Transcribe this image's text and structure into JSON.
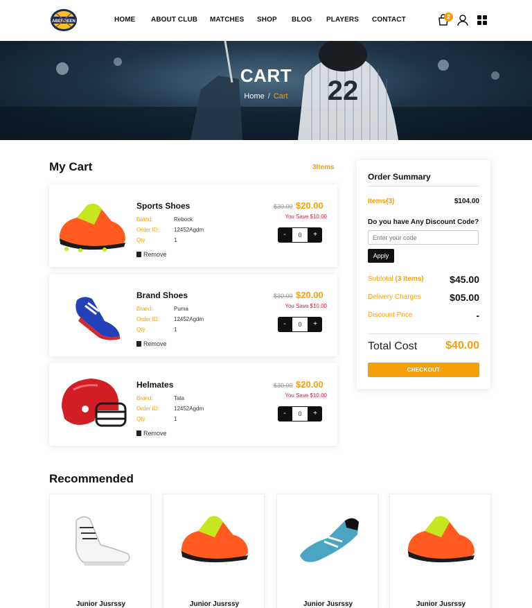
{
  "brand": {
    "logo_text": "ABERDEEN",
    "accent": "#f5a00b"
  },
  "nav": [
    {
      "label": "HOME"
    },
    {
      "label": "ABOUT CLUB"
    },
    {
      "label": "MATCHES"
    },
    {
      "label": "SHOP"
    },
    {
      "label": "BLOG"
    },
    {
      "label": "PLAYERS"
    },
    {
      "label": "CONTACT"
    }
  ],
  "header_icons": {
    "cart": "bag-icon",
    "cart_count": "2",
    "user": "user-icon",
    "menu": "grid-icon"
  },
  "hero": {
    "title": "CART",
    "breadcrumb_home": "Home",
    "breadcrumb_sep": "/",
    "breadcrumb_current": "Cart"
  },
  "cart": {
    "title": "My Cart",
    "count_label": "3Items",
    "labels": {
      "brand": "Brand:",
      "order_id": "Order ID:",
      "qty": "Qty",
      "remove": "Remove",
      "you_save": "You Save"
    },
    "items": [
      {
        "name": "Sports Shoes",
        "brand": "Rebock",
        "order_id": "12452Agdm",
        "qty": "1",
        "old_price": "$30.00",
        "price": "$20.00",
        "save": "You Save $10.00",
        "stepper_value": "0",
        "image": "orange-cleats"
      },
      {
        "name": "Brand Shoes",
        "brand": "Puma",
        "order_id": "12452Agdm",
        "qty": "1",
        "old_price": "$30.00",
        "price": "$20.00",
        "save": "You Save $10.00",
        "stepper_value": "0",
        "image": "blue-cleats"
      },
      {
        "name": "Helmates",
        "brand": "Tata",
        "order_id": "12452Agdm",
        "qty": "1",
        "old_price": "$30.00",
        "price": "$20.00",
        "save": "You Save $10.00",
        "stepper_value": "0",
        "image": "red-helmet"
      }
    ],
    "stepper": {
      "minus": "-",
      "plus": "+"
    }
  },
  "summary": {
    "title": "Order Summary",
    "items_label": "Items(3)",
    "items_value": "$104.00",
    "discount_question": "Do you have Any Discount Code?",
    "discount_placeholder": "Enter your code",
    "apply_label": "Apply",
    "subtotal_label": "Subtotal",
    "subtotal_items": "(3 Items)",
    "subtotal_value": "$45.00",
    "delivery_label": "Delivery Charges",
    "delivery_value": "$05.00",
    "discount_label": "Discount Price",
    "discount_value": "-",
    "total_label": "Total Cost",
    "total_value": "$40.00",
    "checkout_label": "CHECKOUT"
  },
  "recommended": {
    "title": "Recommended",
    "items": [
      {
        "name": "Junior Jusrssy",
        "image": "white-sneakers"
      },
      {
        "name": "Junior Jusrssy",
        "image": "orange-cleats"
      },
      {
        "name": "Junior Jusrssy",
        "image": "teal-cleat"
      },
      {
        "name": "Junior Jusrssy",
        "image": "orange-cleats"
      }
    ]
  }
}
